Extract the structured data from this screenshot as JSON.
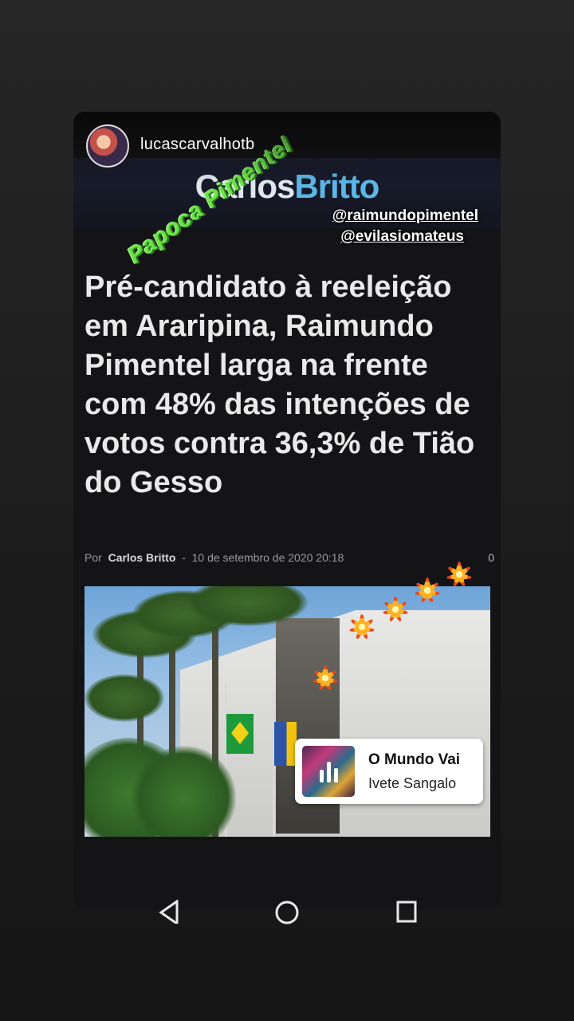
{
  "story": {
    "username": "lucascarvalhotb",
    "mentions": [
      "@raimundopimentel",
      "@evilasiomateus"
    ]
  },
  "article": {
    "brand_part1": "Carlos",
    "brand_part2": "Britto",
    "headline": "Pré-candidato à reeleição em Araripina, Raimundo Pimentel larga na frente com 48% das intenções de votos contra 36,3% de Tião do Gesso",
    "byline_prefix": "Por",
    "author": "Carlos Britto",
    "separator": "-",
    "date": "10 de setembro de 2020 20:18",
    "comment_count": "0"
  },
  "gif_sticker": {
    "text": "Papoca Pimentel"
  },
  "music_sticker": {
    "title": "O Mundo Vai",
    "artist": "Ivete Sangalo"
  },
  "colors": {
    "brand_primary": "#dfe6ee",
    "brand_accent": "#5cb6e6",
    "gif_green": "#6be04a"
  },
  "nav": {
    "back_icon": "back-triangle-icon",
    "home_icon": "home-circle-icon",
    "recents_icon": "recents-square-icon"
  }
}
